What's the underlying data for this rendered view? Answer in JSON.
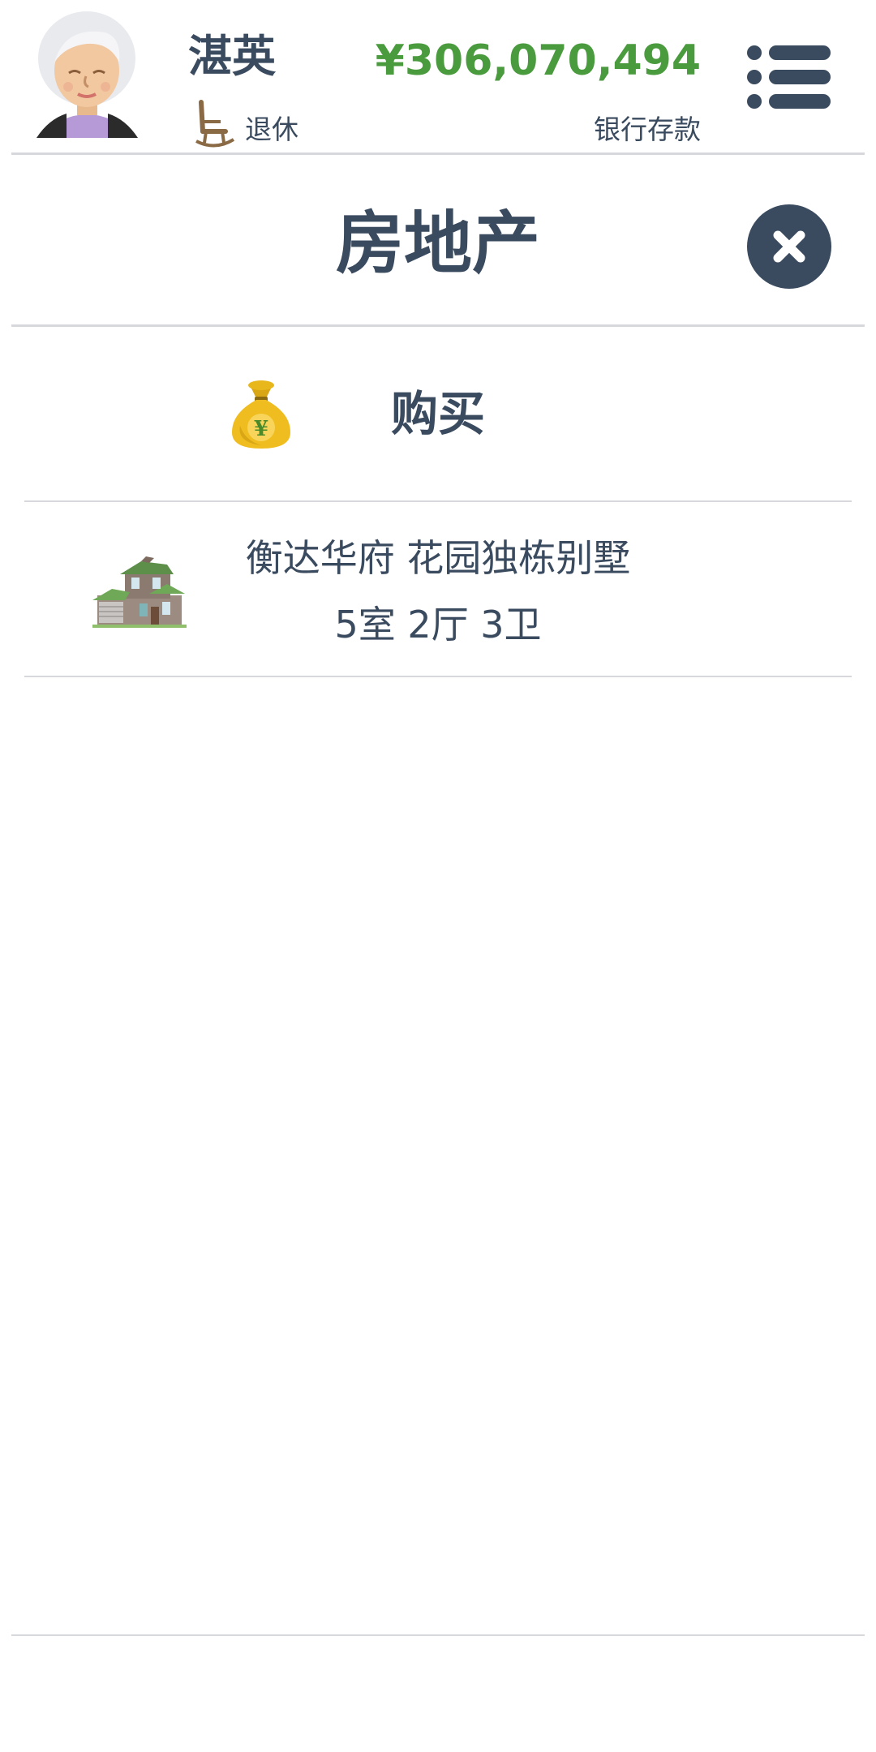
{
  "header": {
    "player_name": "湛英",
    "status": "退休",
    "status_icon": "rocking-chair-icon",
    "balance": "¥306,070,494",
    "balance_label": "银行存款",
    "menu_icon": "menu-list-icon"
  },
  "dialog": {
    "title": "房地产",
    "close_icon": "close-icon"
  },
  "actions": [
    {
      "label": "购买",
      "icon": "money-bag-icon"
    }
  ],
  "properties": [
    {
      "name": "衡达华府 花园独栋别墅",
      "rooms": "5室 2厅 3卫",
      "icon": "house-icon"
    }
  ],
  "colors": {
    "text": "#3a4a5f",
    "balance": "#4a9a3e",
    "divider": "#d6d8dc",
    "close_button": "#3a4a5f"
  }
}
